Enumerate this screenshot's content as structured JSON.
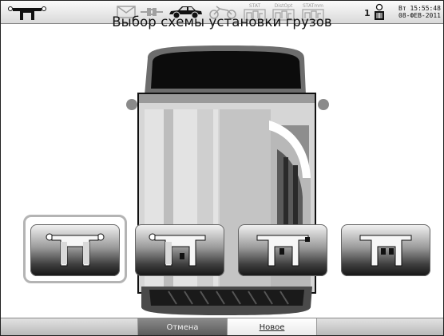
{
  "header": {
    "icons": [
      "wheel-logo-icon",
      "envelope-icon",
      "plug-icon",
      "car-icon",
      "motorcycle-icon",
      "stat-icon",
      "distopt-icon",
      "statmm-icon",
      "user-icon"
    ],
    "stat_label": "STAT",
    "distopt_label": "DistOpt",
    "statmm_label": "STATmm",
    "user_number": "1",
    "clock_line1": "Вт 15:55:48",
    "clock_line2": "08-ФЕВ-2011"
  },
  "page": {
    "title": "Выбор схемы установки грузов"
  },
  "schemes": [
    {
      "id": "scheme-1",
      "selected": true
    },
    {
      "id": "scheme-2",
      "selected": false
    },
    {
      "id": "scheme-3",
      "selected": false
    },
    {
      "id": "scheme-4",
      "selected": false
    }
  ],
  "footer": {
    "cancel_label": "Отмена",
    "new_label": "Новое"
  }
}
